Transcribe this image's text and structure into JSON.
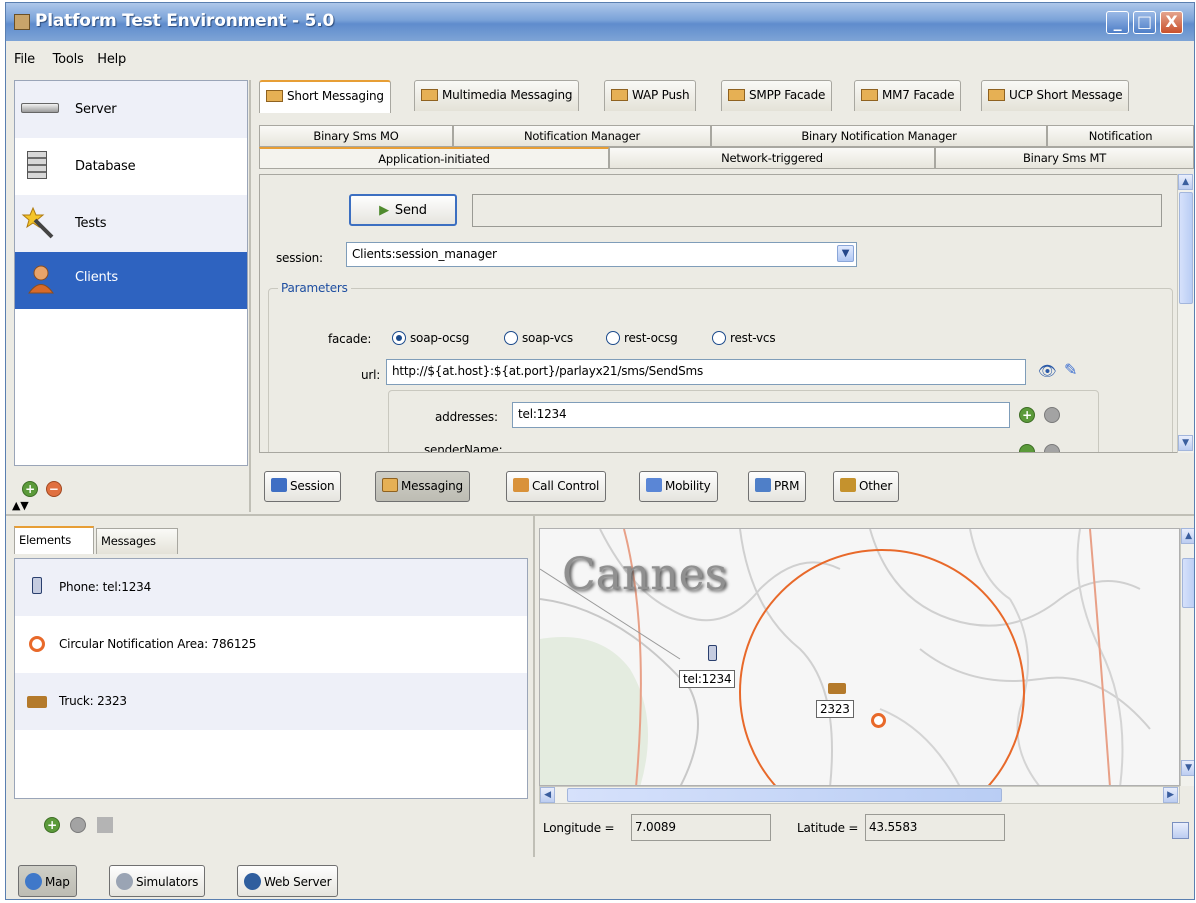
{
  "window": {
    "title": "Platform Test Environment - 5.0",
    "minimize": "_",
    "maximize": "□",
    "close": "X"
  },
  "menu": [
    "File",
    "Tools",
    "Help"
  ],
  "nav": {
    "items": [
      {
        "label": "Server"
      },
      {
        "label": "Database"
      },
      {
        "label": "Tests"
      },
      {
        "label": "Clients"
      }
    ],
    "selected": "Clients",
    "add": "+",
    "remove": "−"
  },
  "tabs": {
    "top": [
      "Short Messaging",
      "Multimedia Messaging",
      "WAP Push",
      "SMPP Facade",
      "MM7 Facade",
      "UCP Short Message"
    ],
    "row1": [
      "Binary Sms MO",
      "Notification Manager",
      "Binary Notification Manager",
      "Notification"
    ],
    "row2": [
      "Application-initiated",
      "Network-triggered",
      "Binary Sms MT"
    ]
  },
  "form": {
    "send_label": "Send",
    "session_label": "session:",
    "session_value": "Clients:session_manager",
    "parameters_title": "Parameters",
    "facade_label": "facade:",
    "facade_options": [
      "soap-ocsg",
      "soap-vcs",
      "rest-ocsg",
      "rest-vcs"
    ],
    "facade_selected": "soap-ocsg",
    "url_label": "url:",
    "url_value": "http://${at.host}:${at.port}/parlayx21/sms/SendSms",
    "addresses_label": "addresses:",
    "addresses_value": "tel:1234",
    "sendername_label": "senderName:"
  },
  "categories": [
    "Session",
    "Messaging",
    "Call Control",
    "Mobility",
    "PRM",
    "Other"
  ],
  "category_selected": "Messaging",
  "bottom_tabs": [
    "Elements",
    "Messages"
  ],
  "elements": [
    {
      "label": "Phone: tel:1234",
      "icon": "phone-icon"
    },
    {
      "label": "Circular Notification Area: 786125",
      "icon": "target-icon"
    },
    {
      "label": "Truck: 2323",
      "icon": "truck-icon"
    }
  ],
  "map": {
    "city": "Cannes",
    "phone_label": "tel:1234",
    "truck_label": "2323",
    "longitude_label": "Longitude =",
    "longitude_value": "7.0089",
    "latitude_label": "Latitude =",
    "latitude_value": "43.5583"
  },
  "footer_tabs": [
    "Map",
    "Simulators",
    "Web Server"
  ],
  "footer_selected": "Map",
  "colors": {
    "selection": "#2e63c0",
    "accent_tab": "#e79e35",
    "map_circle": "#e8692a"
  }
}
